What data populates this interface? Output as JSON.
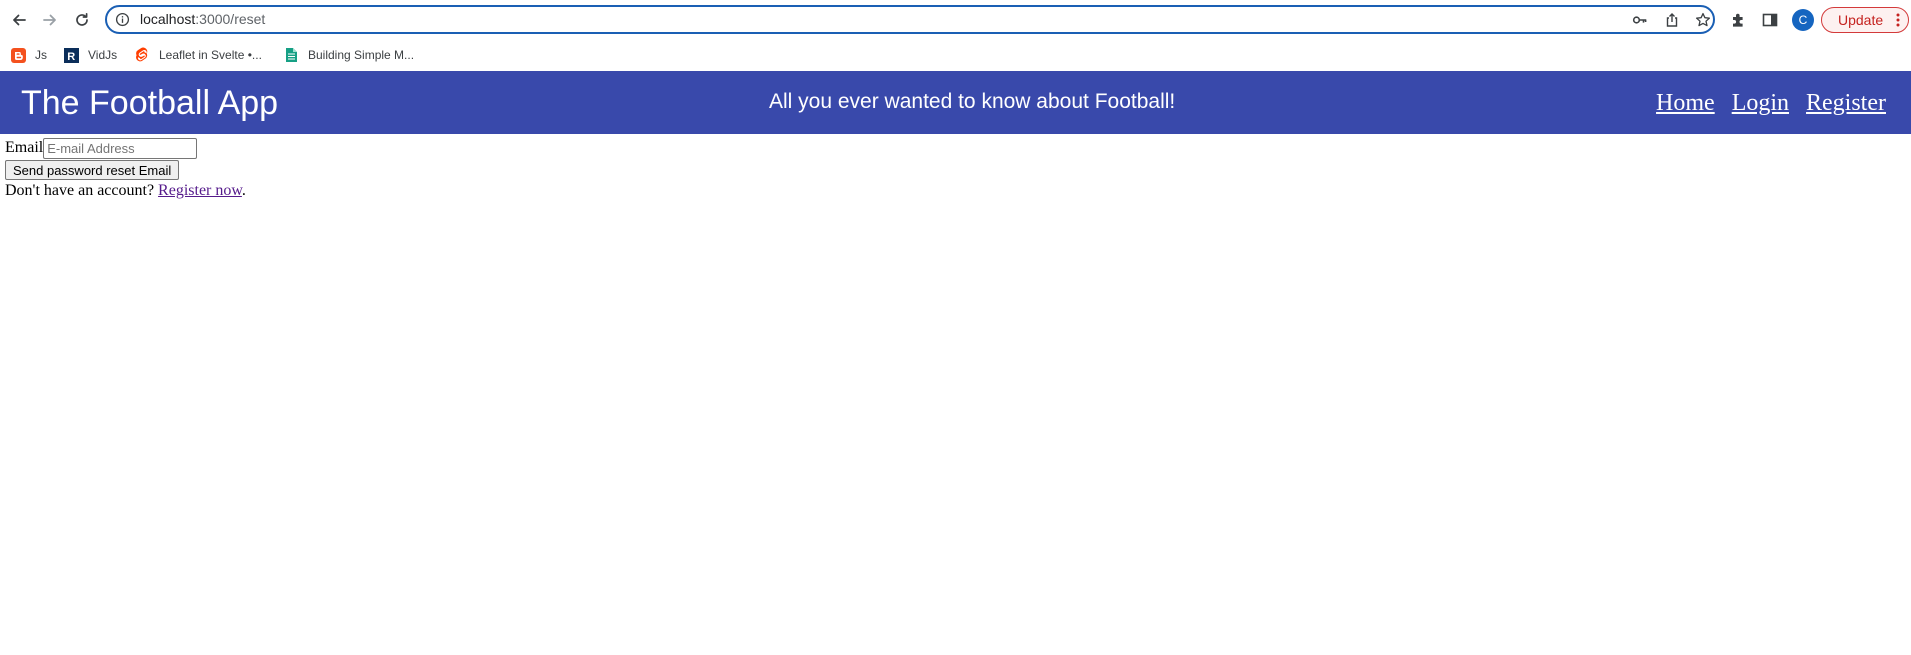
{
  "browser": {
    "url_host": "localhost",
    "url_path": ":3000/reset",
    "avatar_letter": "C",
    "update_label": "Update",
    "bookmarks": [
      {
        "label": "Js",
        "icon": "blogger-icon",
        "color": "#f4511e"
      },
      {
        "label": "VidJs",
        "icon": "r-logo-icon",
        "color": "#0b2e5a"
      },
      {
        "label": "Leaflet in Svelte •...",
        "icon": "svelte-icon",
        "color": "#ff3e00"
      },
      {
        "label": "Building Simple M...",
        "icon": "document-icon",
        "color": "#16a085"
      }
    ]
  },
  "header": {
    "title": "The Football App",
    "tagline": "All you ever wanted to know about Football!",
    "nav": [
      "Home",
      "Login",
      "Register"
    ],
    "background": "#3949ab"
  },
  "form": {
    "email_label": "Email",
    "email_placeholder": "E-mail Address",
    "submit_label": "Send password reset Email",
    "prompt_text": "Don't have an account?",
    "register_link": "Register now",
    "trailing": "."
  }
}
